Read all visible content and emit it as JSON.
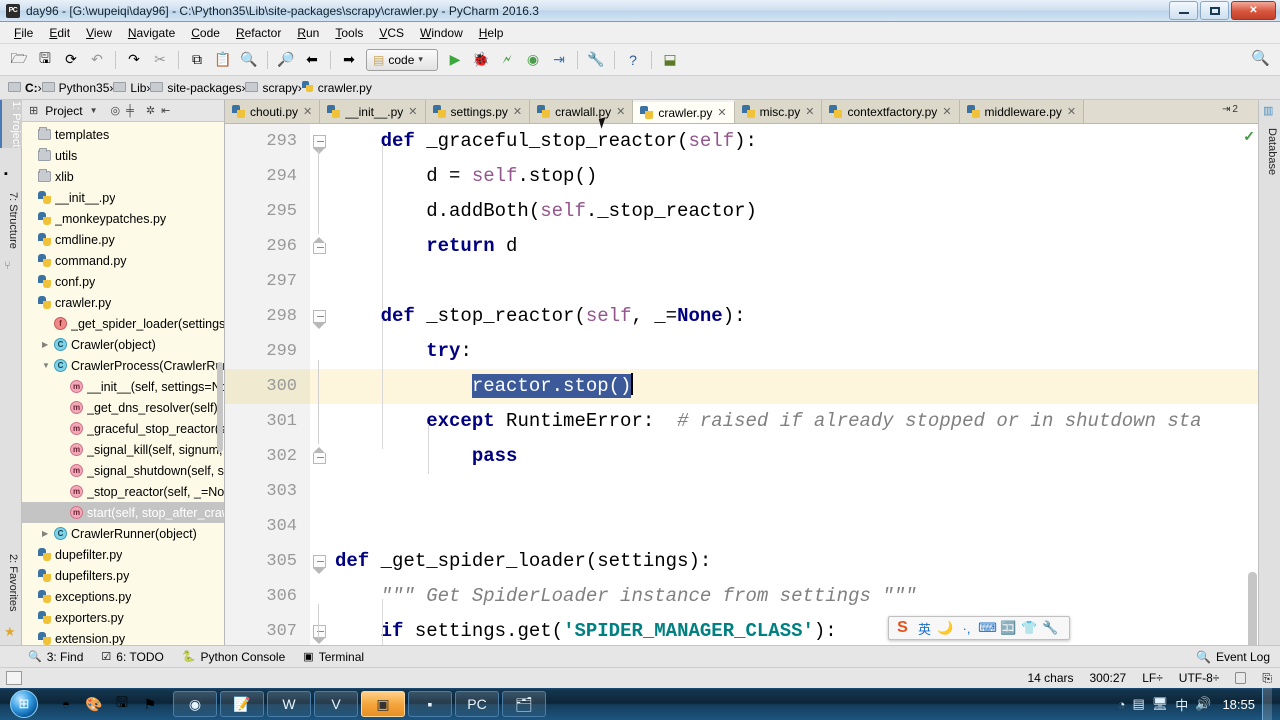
{
  "window": {
    "title": "day96 - [G:\\wupeiqi\\day96] - C:\\Python35\\Lib\\site-packages\\scrapy\\crawler.py - PyCharm 2016.3",
    "app_icon": "pycharm-icon",
    "minimize": "–",
    "maximize": "□",
    "close": "✕"
  },
  "menu": {
    "items": [
      "File",
      "Edit",
      "View",
      "Navigate",
      "Code",
      "Refactor",
      "Run",
      "Tools",
      "VCS",
      "Window",
      "Help"
    ]
  },
  "toolbar": {
    "buttons": [
      {
        "name": "open-folder-icon",
        "glyph": "🗁"
      },
      {
        "name": "save-all-icon",
        "glyph": "🖫"
      },
      {
        "name": "sync-icon",
        "glyph": "⟳"
      },
      {
        "name": "undo-icon",
        "glyph": "↶"
      },
      {
        "name": "redo-icon",
        "glyph": "↷"
      },
      {
        "name": "cut-icon",
        "glyph": "✂"
      },
      {
        "name": "copy-icon",
        "glyph": "⧉"
      },
      {
        "name": "paste-icon",
        "glyph": "📋"
      },
      {
        "name": "find-icon",
        "glyph": "🔍"
      },
      {
        "name": "replace-icon",
        "glyph": "🔎"
      },
      {
        "name": "back-icon",
        "glyph": "⬅"
      },
      {
        "name": "forward-icon",
        "glyph": "➡"
      }
    ],
    "run_config": "code",
    "run_config_dropdown": "▾",
    "run_buttons": [
      {
        "name": "run-icon",
        "glyph": "▶"
      },
      {
        "name": "debug-icon",
        "glyph": "🐞"
      },
      {
        "name": "run-coverage-icon",
        "glyph": "🗲"
      },
      {
        "name": "profile-icon",
        "glyph": "◉"
      },
      {
        "name": "attach-icon",
        "glyph": "⇥"
      },
      {
        "name": "settings-icon",
        "glyph": "🔧"
      },
      {
        "name": "help-icon",
        "glyph": "?"
      },
      {
        "name": "vcs-update-icon",
        "glyph": "⬓"
      }
    ],
    "search_icon": "🔍"
  },
  "breadcrumb": {
    "items": [
      "C:",
      "Python35",
      "Lib",
      "site-packages",
      "scrapy",
      "crawler.py"
    ],
    "separator": "›"
  },
  "left_tool_strip": [
    {
      "label": "1: Project",
      "selected": true,
      "icon": "project-icon"
    },
    {
      "label": "7: Structure",
      "selected": false,
      "icon": "structure-icon"
    },
    {
      "label": "2: Favorites",
      "selected": false,
      "icon": "star-icon"
    }
  ],
  "right_tool_strip": [
    {
      "label": "Database",
      "icon": "database-icon"
    }
  ],
  "project_panel": {
    "header_label": "Project",
    "header_icons": [
      "project-view-icon",
      "chevron-down-icon",
      "target-icon",
      "collapse-icon",
      "gear-icon",
      "hide-icon"
    ],
    "tree": [
      {
        "label": "templates",
        "indent": 0,
        "icon": "folder",
        "arrow": "",
        "selected": false
      },
      {
        "label": "utils",
        "indent": 0,
        "icon": "folder",
        "arrow": "",
        "selected": false
      },
      {
        "label": "xlib",
        "indent": 0,
        "icon": "folder",
        "arrow": "",
        "selected": false
      },
      {
        "label": "__init__.py",
        "indent": 0,
        "icon": "py",
        "arrow": "",
        "selected": false
      },
      {
        "label": "_monkeypatches.py",
        "indent": 0,
        "icon": "py",
        "arrow": "",
        "selected": false
      },
      {
        "label": "cmdline.py",
        "indent": 0,
        "icon": "py",
        "arrow": "",
        "selected": false
      },
      {
        "label": "command.py",
        "indent": 0,
        "icon": "py",
        "arrow": "",
        "selected": false
      },
      {
        "label": "conf.py",
        "indent": 0,
        "icon": "py",
        "arrow": "",
        "selected": false
      },
      {
        "label": "crawler.py",
        "indent": 0,
        "icon": "py",
        "arrow": "",
        "selected": false
      },
      {
        "label": "_get_spider_loader(settings)",
        "indent": 1,
        "icon": "fn",
        "arrow": "",
        "selected": false
      },
      {
        "label": "Crawler(object)",
        "indent": 1,
        "icon": "cls",
        "arrow": "▶",
        "selected": false
      },
      {
        "label": "CrawlerProcess(CrawlerRunn",
        "indent": 1,
        "icon": "cls",
        "arrow": "▼",
        "selected": false
      },
      {
        "label": "__init__(self, settings=Non",
        "indent": 2,
        "icon": "mth",
        "arrow": "",
        "selected": false
      },
      {
        "label": "_get_dns_resolver(self)",
        "indent": 2,
        "icon": "mth",
        "arrow": "",
        "selected": false
      },
      {
        "label": "_graceful_stop_reactor(se",
        "indent": 2,
        "icon": "mth",
        "arrow": "",
        "selected": false
      },
      {
        "label": "_signal_kill(self, signum, _",
        "indent": 2,
        "icon": "mth",
        "arrow": "",
        "selected": false
      },
      {
        "label": "_signal_shutdown(self, sig",
        "indent": 2,
        "icon": "mth",
        "arrow": "",
        "selected": false
      },
      {
        "label": "_stop_reactor(self, _=No",
        "indent": 2,
        "icon": "mth",
        "arrow": "",
        "selected": false
      },
      {
        "label": "start(self, stop_after_craw",
        "indent": 2,
        "icon": "mth",
        "arrow": "",
        "selected": true
      },
      {
        "label": "CrawlerRunner(object)",
        "indent": 1,
        "icon": "cls",
        "arrow": "▶",
        "selected": false
      },
      {
        "label": "dupefilter.py",
        "indent": 0,
        "icon": "py",
        "arrow": "",
        "selected": false
      },
      {
        "label": "dupefilters.py",
        "indent": 0,
        "icon": "py",
        "arrow": "",
        "selected": false
      },
      {
        "label": "exceptions.py",
        "indent": 0,
        "icon": "py",
        "arrow": "",
        "selected": false
      },
      {
        "label": "exporters.py",
        "indent": 0,
        "icon": "py",
        "arrow": "",
        "selected": false
      },
      {
        "label": "extension.py",
        "indent": 0,
        "icon": "py",
        "arrow": "",
        "selected": false
      }
    ]
  },
  "editor_tabs": {
    "tabs": [
      {
        "label": "chouti.py",
        "active": false,
        "close": "✕"
      },
      {
        "label": "__init__.py",
        "active": false,
        "close": "✕"
      },
      {
        "label": "settings.py",
        "active": false,
        "close": "✕"
      },
      {
        "label": "crawlall.py",
        "active": false,
        "close": "✕"
      },
      {
        "label": "crawler.py",
        "active": true,
        "close": "✕"
      },
      {
        "label": "misc.py",
        "active": false,
        "close": "✕"
      },
      {
        "label": "contextfactory.py",
        "active": false,
        "close": "✕"
      },
      {
        "label": "middleware.py",
        "active": false,
        "close": "✕"
      }
    ],
    "overflow_label": "2",
    "overflow_icon": "⇥"
  },
  "editor": {
    "inspection_mark": "✓",
    "lines": [
      {
        "num": "293",
        "fold": "open",
        "current": false,
        "tokens": [
          {
            "t": "    ",
            "c": ""
          },
          {
            "t": "def",
            "c": "k"
          },
          {
            "t": " _graceful_stop_reactor(",
            "c": ""
          },
          {
            "t": "self",
            "c": "sf"
          },
          {
            "t": "):",
            "c": ""
          }
        ]
      },
      {
        "num": "294",
        "fold": "",
        "current": false,
        "tokens": [
          {
            "t": "        d = ",
            "c": ""
          },
          {
            "t": "self",
            "c": "sf"
          },
          {
            "t": ".stop()",
            "c": ""
          }
        ]
      },
      {
        "num": "295",
        "fold": "",
        "current": false,
        "tokens": [
          {
            "t": "        d.addBoth(",
            "c": ""
          },
          {
            "t": "self",
            "c": "sf"
          },
          {
            "t": "._stop_reactor)",
            "c": ""
          }
        ]
      },
      {
        "num": "296",
        "fold": "close",
        "current": false,
        "tokens": [
          {
            "t": "        ",
            "c": ""
          },
          {
            "t": "return",
            "c": "k"
          },
          {
            "t": " d",
            "c": ""
          }
        ]
      },
      {
        "num": "297",
        "fold": "",
        "current": false,
        "tokens": []
      },
      {
        "num": "298",
        "fold": "open",
        "current": false,
        "tokens": [
          {
            "t": "    ",
            "c": ""
          },
          {
            "t": "def",
            "c": "k"
          },
          {
            "t": " _stop_reactor(",
            "c": ""
          },
          {
            "t": "self",
            "c": "sf"
          },
          {
            "t": ", _=",
            "c": ""
          },
          {
            "t": "None",
            "c": "k"
          },
          {
            "t": "):",
            "c": ""
          }
        ]
      },
      {
        "num": "299",
        "fold": "",
        "current": false,
        "tokens": [
          {
            "t": "        ",
            "c": ""
          },
          {
            "t": "try",
            "c": "k"
          },
          {
            "t": ":",
            "c": ""
          }
        ]
      },
      {
        "num": "300",
        "fold": "",
        "current": true,
        "tokens": [
          {
            "t": "            ",
            "c": ""
          },
          {
            "t": "reactor.stop()",
            "c": "selected"
          }
        ]
      },
      {
        "num": "301",
        "fold": "",
        "current": false,
        "tokens": [
          {
            "t": "        ",
            "c": ""
          },
          {
            "t": "except",
            "c": "k"
          },
          {
            "t": " RuntimeError:  ",
            "c": ""
          },
          {
            "t": "# raised if already stopped or in shutdown sta",
            "c": "cm"
          }
        ]
      },
      {
        "num": "302",
        "fold": "close",
        "current": false,
        "tokens": [
          {
            "t": "            ",
            "c": ""
          },
          {
            "t": "pass",
            "c": "k"
          }
        ]
      },
      {
        "num": "303",
        "fold": "",
        "current": false,
        "tokens": []
      },
      {
        "num": "304",
        "fold": "",
        "current": false,
        "tokens": []
      },
      {
        "num": "305",
        "fold": "open-top",
        "current": false,
        "tokens": [
          {
            "t": "def",
            "c": "k"
          },
          {
            "t": " _get_spider_loader(settings):",
            "c": ""
          }
        ]
      },
      {
        "num": "306",
        "fold": "",
        "current": false,
        "tokens": [
          {
            "t": "    ",
            "c": ""
          },
          {
            "t": "\"\"\" Get SpiderLoader instance from settings \"\"\"",
            "c": "ds"
          }
        ]
      },
      {
        "num": "307",
        "fold": "open",
        "current": false,
        "tokens": [
          {
            "t": "    ",
            "c": ""
          },
          {
            "t": "if",
            "c": "k"
          },
          {
            "t": " settings.get(",
            "c": ""
          },
          {
            "t": "'SPIDER_MANAGER_CLASS'",
            "c": "s"
          },
          {
            "t": "):",
            "c": ""
          }
        ]
      }
    ]
  },
  "ime_toolbar": {
    "items": [
      {
        "name": "sogou-logo-icon",
        "glyph": "S"
      },
      {
        "name": "language-mode-icon",
        "glyph": "英"
      },
      {
        "name": "moon-icon",
        "glyph": "🌙"
      },
      {
        "name": "punctuation-icon",
        "glyph": "·,"
      },
      {
        "name": "soft-keyboard-icon",
        "glyph": "⌨"
      },
      {
        "name": "input-method-icon",
        "glyph": "🈁"
      },
      {
        "name": "skin-icon",
        "glyph": "👕"
      },
      {
        "name": "toolbox-icon",
        "glyph": "🔧"
      }
    ]
  },
  "bottom_bar": {
    "buttons": [
      {
        "label": "3: Find",
        "icon": "find-icon",
        "accel": "3"
      },
      {
        "label": "6: TODO",
        "icon": "todo-icon",
        "accel": "6"
      },
      {
        "label": "Python Console",
        "icon": "python-console-icon",
        "accel": ""
      },
      {
        "label": "Terminal",
        "icon": "terminal-icon",
        "accel": ""
      }
    ],
    "event_log": {
      "label": "Event Log",
      "icon": "event-log-icon"
    }
  },
  "status_bar": {
    "chars": "14 chars",
    "caret": "300:27",
    "line_separator": "LF÷",
    "encoding": "UTF-8÷",
    "lock_icon": "lock-icon",
    "vcs_icon": "vcs-branch-icon"
  },
  "taskbar": {
    "start": "start-orb",
    "quick_launch": [
      {
        "name": "media-player-icon",
        "glyph": "◓"
      },
      {
        "name": "paint-icon",
        "glyph": "🎨"
      },
      {
        "name": "save-icon",
        "glyph": "🖫"
      },
      {
        "name": "flag-icon",
        "glyph": "⚑"
      }
    ],
    "tasks": [
      {
        "name": "chrome-task",
        "glyph": "◉",
        "active": false
      },
      {
        "name": "notepad-task",
        "glyph": "📝",
        "active": false
      },
      {
        "name": "word-task",
        "glyph": "W",
        "active": false
      },
      {
        "name": "vegas-task",
        "glyph": "V",
        "active": false
      },
      {
        "name": "folder-task",
        "glyph": "▣",
        "active": true
      },
      {
        "name": "cmd-task",
        "glyph": "▪",
        "active": false
      },
      {
        "name": "pycharm-task",
        "glyph": "PC",
        "active": false
      },
      {
        "name": "explorer-task",
        "glyph": "🗂",
        "active": false
      }
    ],
    "tray": [
      {
        "name": "tray-app-icon",
        "glyph": "◔"
      },
      {
        "name": "tray-network-windows-icon",
        "glyph": "▤"
      },
      {
        "name": "tray-monitor-icon",
        "glyph": "🖥"
      },
      {
        "name": "tray-ime-icon",
        "glyph": "中"
      },
      {
        "name": "tray-volume-icon",
        "glyph": "🔊"
      }
    ],
    "clock": "18:55"
  }
}
